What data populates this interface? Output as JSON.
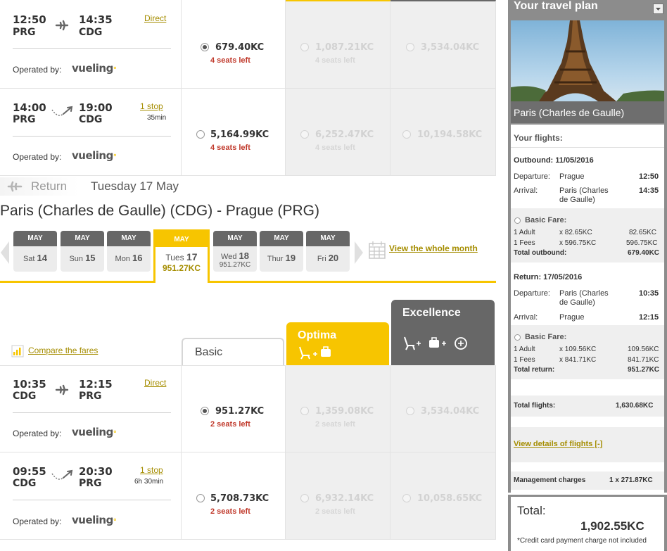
{
  "outbound_rows": [
    {
      "dep_time": "12:50",
      "dep_code": "PRG",
      "arr_time": "14:35",
      "arr_code": "CDG",
      "stop_label": "Direct",
      "stop_detail": "",
      "operated_by": "Operated by:",
      "carrier": "vueling",
      "fares": [
        {
          "price": "679.40KC",
          "seats": "4 seats left",
          "selected": true,
          "available": true
        },
        {
          "price": "1,087.21KC",
          "seats": "4 seats left",
          "available": false
        },
        {
          "price": "3,534.04KC",
          "seats": "",
          "available": false
        }
      ]
    },
    {
      "dep_time": "14:00",
      "dep_code": "PRG",
      "arr_time": "19:00",
      "arr_code": "CDG",
      "stop_label": "1 stop",
      "stop_detail": "35min",
      "operated_by": "Operated by:",
      "carrier": "vueling",
      "fares": [
        {
          "price": "5,164.99KC",
          "seats": "4 seats left",
          "selected": false,
          "available": true
        },
        {
          "price": "6,252.47KC",
          "seats": "4 seats left",
          "available": false
        },
        {
          "price": "10,194.58KC",
          "seats": "",
          "available": false
        }
      ]
    }
  ],
  "return_header": {
    "return_button": "Return",
    "date": "Tuesday 17 May",
    "route": "Paris (Charles de Gaulle) (CDG) - Prague (PRG)"
  },
  "dates": [
    {
      "month": "MAY",
      "day": "Sat",
      "num": "14",
      "price": ""
    },
    {
      "month": "MAY",
      "day": "Sun",
      "num": "15",
      "price": ""
    },
    {
      "month": "MAY",
      "day": "Mon",
      "num": "16",
      "price": ""
    },
    {
      "month": "MAY",
      "day": "Tues",
      "num": "17",
      "price": "951.27KC",
      "active": true
    },
    {
      "month": "MAY",
      "day": "Wed",
      "num": "18",
      "price": "951.27KC"
    },
    {
      "month": "MAY",
      "day": "Thur",
      "num": "19",
      "price": ""
    },
    {
      "month": "MAY",
      "day": "Fri",
      "num": "20",
      "price": ""
    }
  ],
  "view_month": "View the whole month",
  "compare_fares": "Compare the fares",
  "fare_tabs": {
    "basic": "Basic",
    "optima": "Optima",
    "excellence": "Excellence"
  },
  "return_rows": [
    {
      "dep_time": "10:35",
      "dep_code": "CDG",
      "arr_time": "12:15",
      "arr_code": "PRG",
      "stop_label": "Direct",
      "stop_detail": "",
      "operated_by": "Operated by:",
      "carrier": "vueling",
      "fares": [
        {
          "price": "951.27KC",
          "seats": "2 seats left",
          "selected": true,
          "available": true
        },
        {
          "price": "1,359.08KC",
          "seats": "2 seats left",
          "available": false
        },
        {
          "price": "3,534.04KC",
          "seats": "",
          "available": false
        }
      ]
    },
    {
      "dep_time": "09:55",
      "dep_code": "CDG",
      "arr_time": "20:30",
      "arr_code": "PRG",
      "stop_label": "1 stop",
      "stop_detail": "6h  30min",
      "operated_by": "Operated by:",
      "carrier": "vueling",
      "fares": [
        {
          "price": "5,708.73KC",
          "seats": "2 seats left",
          "selected": false,
          "available": true
        },
        {
          "price": "6,932.14KC",
          "seats": "2 seats left",
          "available": false
        },
        {
          "price": "10,058.65KC",
          "seats": "",
          "available": false
        }
      ]
    }
  ],
  "plan": {
    "title": "Your travel plan",
    "destination": "Paris (Charles de Gaulle)",
    "your_flights": "Your flights:",
    "outbound": {
      "heading": "Outbound: 11/05/2016",
      "dep_label": "Departure:",
      "dep_city": "Prague",
      "dep_time": "12:50",
      "arr_label": "Arrival:",
      "arr_city": "Paris (Charles de Gaulle)",
      "arr_time": "14:35",
      "fare": "Basic Fare:",
      "adult_label": "1 Adult",
      "adult_calc": "x 82.65KC",
      "adult_total": "82.65KC",
      "fees_label": "1 Fees",
      "fees_calc": "x 596.75KC",
      "fees_total": "596.75KC",
      "total_label": "Total outbound:",
      "total": "679.40KC"
    },
    "return": {
      "heading": "Return: 17/05/2016",
      "dep_label": "Departure:",
      "dep_city": "Paris (Charles de Gaulle)",
      "dep_time": "10:35",
      "arr_label": "Arrival:",
      "arr_city": "Prague",
      "arr_time": "12:15",
      "fare": "Basic Fare:",
      "adult_label": "1 Adult",
      "adult_calc": "x 109.56KC",
      "adult_total": "109.56KC",
      "fees_label": "1 Fees",
      "fees_calc": "x 841.71KC",
      "fees_total": "841.71KC",
      "total_label": "Total return:",
      "total": "951.27KC"
    },
    "total_flights_label": "Total flights:",
    "total_flights": "1,630.68KC",
    "view_details": "View details of flights [-]",
    "mgmt_label": "Management charges",
    "mgmt_value": "1 x 271.87KC",
    "total_label": "Total:",
    "total": "1,902.55KC",
    "cc_note": "*Credit card payment charge not included"
  },
  "colors": {
    "accent": "#f7c500",
    "dark_tab": "#676767",
    "link": "#a58d00",
    "seats": "#c0392b",
    "panel": "#8c8c8c"
  }
}
